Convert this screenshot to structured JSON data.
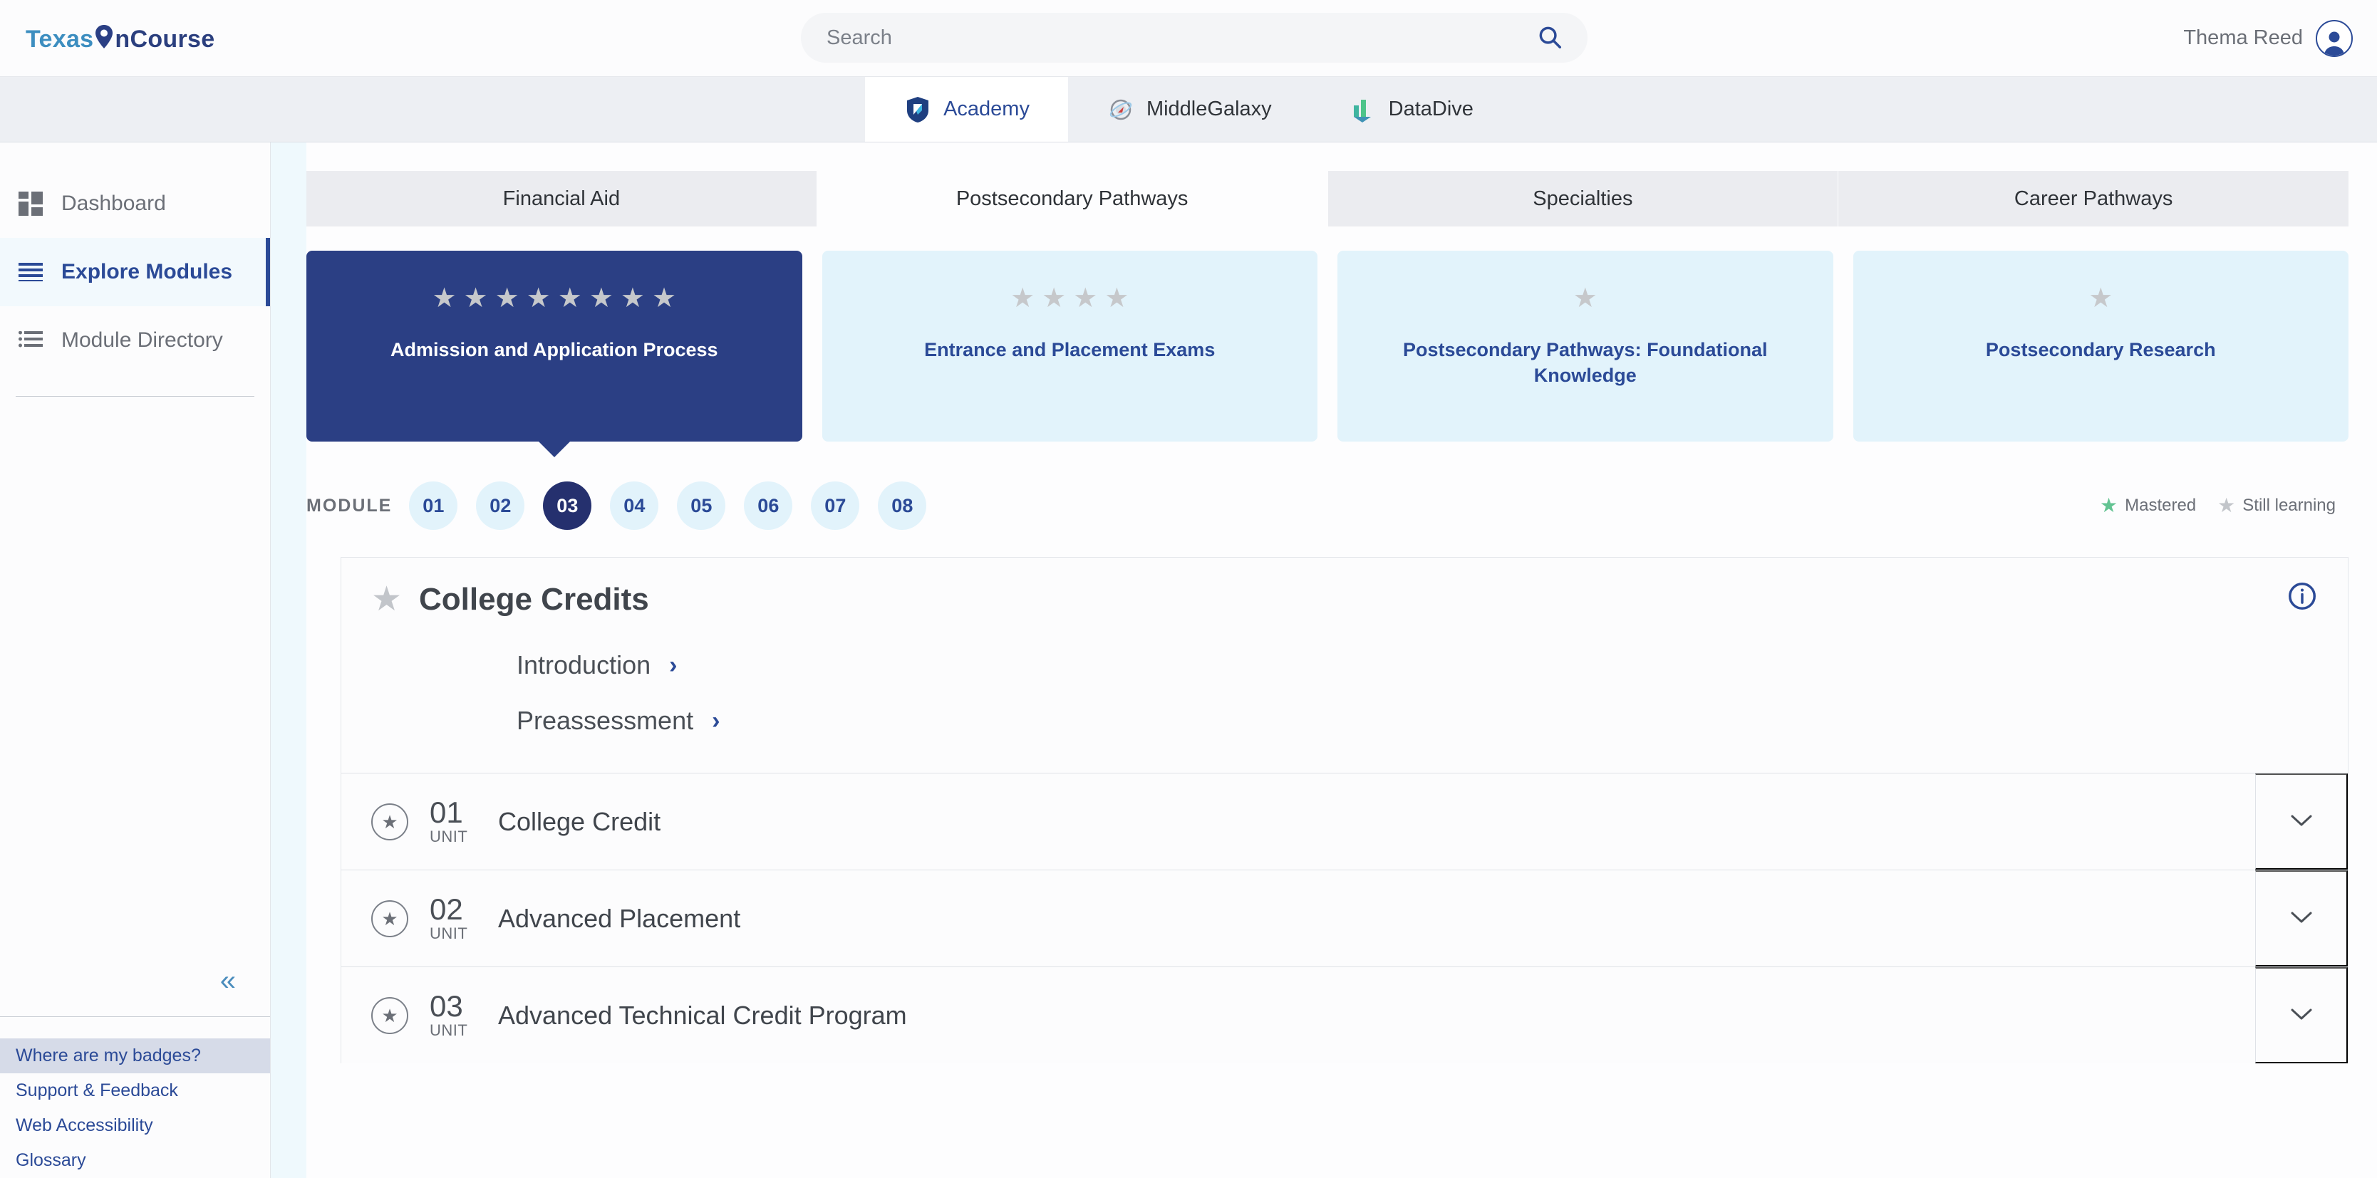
{
  "header": {
    "logo_tex": "Texas",
    "logo_on": "n",
    "logo_course": "Course",
    "search_placeholder": "Search",
    "search_value": "",
    "search_icon": "search-icon",
    "user_name": "Thema Reed",
    "avatar_icon": "user-avatar-icon"
  },
  "app_switcher": {
    "tabs": [
      {
        "label": "Academy",
        "icon": "shield-icon",
        "active": true
      },
      {
        "label": "MiddleGalaxy",
        "icon": "planet-compass-icon",
        "active": false
      },
      {
        "label": "DataDive",
        "icon": "bar-chart-icon",
        "active": false
      }
    ]
  },
  "sidebar": {
    "items": [
      {
        "label": "Dashboard",
        "icon": "grid-icon",
        "active": false
      },
      {
        "label": "Explore Modules",
        "icon": "hamburger-icon",
        "active": true
      },
      {
        "label": "Module Directory",
        "icon": "list-icon",
        "active": false
      }
    ],
    "collapse_label": "«",
    "footer_links": [
      {
        "label": "Where are my badges?",
        "highlight": true
      },
      {
        "label": "Support & Feedback",
        "highlight": false
      },
      {
        "label": "Web Accessibility",
        "highlight": false
      },
      {
        "label": "Glossary",
        "highlight": false
      }
    ]
  },
  "main": {
    "tabs": [
      {
        "label": "Financial Aid",
        "active": false
      },
      {
        "label": "Postsecondary Pathways",
        "active": true
      },
      {
        "label": "Specialties",
        "active": false
      },
      {
        "label": "Career Pathways",
        "active": false
      }
    ],
    "cards": [
      {
        "title": "Admission and Application Process",
        "stars": 8,
        "active": true
      },
      {
        "title": "Entrance and Placement Exams",
        "stars": 4,
        "active": false
      },
      {
        "title": "Postsecondary Pathways: Foundational Knowledge",
        "stars": 1,
        "active": false
      },
      {
        "title": "Postsecondary Research",
        "stars": 1,
        "active": false
      }
    ],
    "modules_label": "MODULE",
    "modules": [
      {
        "label": "01",
        "active": false
      },
      {
        "label": "02",
        "active": false
      },
      {
        "label": "03",
        "active": true
      },
      {
        "label": "04",
        "active": false
      },
      {
        "label": "05",
        "active": false
      },
      {
        "label": "06",
        "active": false
      },
      {
        "label": "07",
        "active": false
      },
      {
        "label": "08",
        "active": false
      }
    ],
    "legend": [
      {
        "label": "Mastered",
        "state": "mastered"
      },
      {
        "label": "Still learning",
        "state": "learning"
      }
    ],
    "panel": {
      "title": "College Credits",
      "status_icon": "star-icon",
      "info_icon": "info-icon",
      "sublinks": [
        {
          "label": "Introduction"
        },
        {
          "label": "Preassessment"
        }
      ],
      "units": [
        {
          "number": "01",
          "word": "UNIT",
          "title": "College Credit"
        },
        {
          "number": "02",
          "word": "UNIT",
          "title": "Advanced Placement"
        },
        {
          "number": "03",
          "word": "UNIT",
          "title": "Advanced Technical Credit Program"
        }
      ]
    }
  },
  "colors": {
    "brand_navy": "#2b3f84",
    "brand_blue": "#2b4a97",
    "card_light": "#e2f3fb",
    "mastered_green": "#63c392",
    "star_gray": "#c2c5ca"
  }
}
